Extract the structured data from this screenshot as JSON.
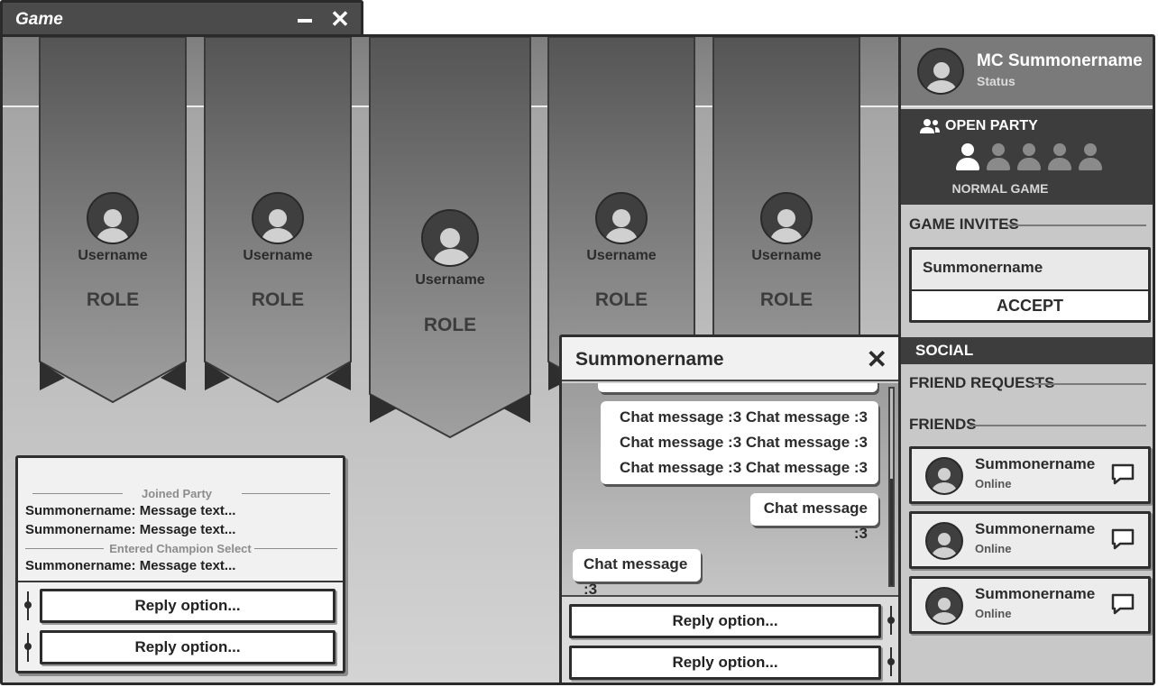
{
  "window": {
    "title": "Game",
    "minimize_icon": "minimize-icon",
    "close_icon": "close-icon",
    "close_glyph": "✕"
  },
  "team": [
    {
      "username": "Username",
      "role": "ROLE"
    },
    {
      "username": "Username",
      "role": "ROLE"
    },
    {
      "username": "Username",
      "role": "ROLE"
    },
    {
      "username": "Username",
      "role": "ROLE"
    },
    {
      "username": "Username",
      "role": "ROLE"
    }
  ],
  "party_chat": {
    "events": [
      "Joined Party",
      "Entered Champion Select"
    ],
    "messages": [
      "Summonername: Message text...",
      "Summonername: Message text...",
      "Summonername: Message text..."
    ],
    "replies": [
      "Reply option...",
      "Reply option..."
    ]
  },
  "chat_window": {
    "title": "Summonername",
    "close_glyph": "✕",
    "messages": [
      {
        "from": "me",
        "text": "Chat message :3 Chat message :3 Chat message :3 Chat message :3 Chat message :3 Chat message :3"
      },
      {
        "from": "me",
        "text": "Chat message :3"
      },
      {
        "from": "them",
        "text": "Chat message :3"
      }
    ],
    "replies": [
      "Reply option...",
      "Reply option..."
    ]
  },
  "profile": {
    "name": "MC Summonername",
    "status": "Status"
  },
  "party": {
    "title": "OPEN PARTY",
    "icon": "party-icon",
    "slots_filled": 1,
    "slots_total": 5,
    "mode": "NORMAL GAME"
  },
  "invites": {
    "heading": "GAME INVITES",
    "from": "Summonername",
    "accept_label": "ACCEPT"
  },
  "social": {
    "heading": "SOCIAL",
    "friend_requests_heading": "FRIEND REQUESTS",
    "friends_heading": "FRIENDS",
    "friends": [
      {
        "name": "Summonername",
        "status": "Online"
      },
      {
        "name": "Summonername",
        "status": "Online"
      },
      {
        "name": "Summonername",
        "status": "Online"
      }
    ]
  },
  "colors": {
    "dark": "#3d3d3d",
    "panel": "#c8c8c8",
    "accent": "#ffffff"
  }
}
